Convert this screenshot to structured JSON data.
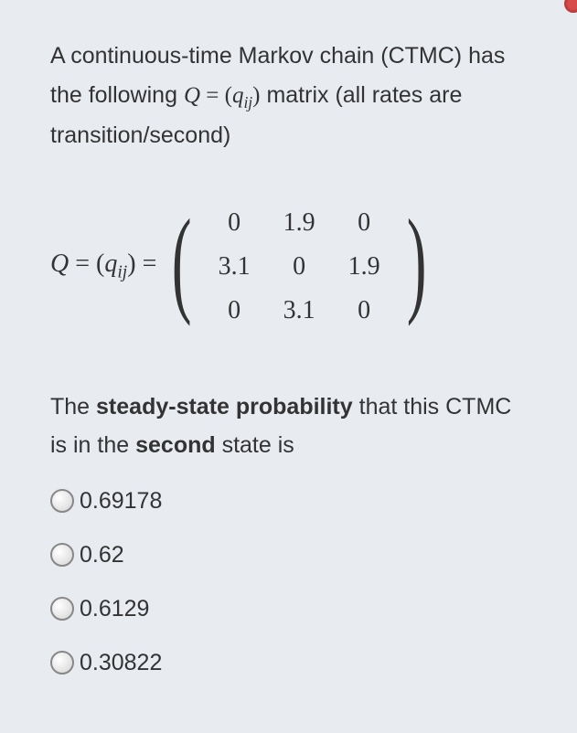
{
  "intro": {
    "pre": "A continuous-time Markov chain (CTMC) has the following ",
    "Q": "Q",
    "eq": " = ",
    "qij_open": "(",
    "q": "q",
    "ij": "ij",
    "qij_close": ")",
    "post": " matrix (all rates are transition/second)"
  },
  "equation": {
    "Q": "Q",
    "eq1": " = ",
    "qij_open": "(",
    "q": "q",
    "ij": "ij",
    "qij_close": ")",
    "eq2": " = "
  },
  "chart_data": {
    "type": "table",
    "title": "Q matrix",
    "rows": [
      [
        "0",
        "1.9",
        "0"
      ],
      [
        "3.1",
        "0",
        "1.9"
      ],
      [
        "0",
        "3.1",
        "0"
      ]
    ]
  },
  "followup": {
    "pre": "The ",
    "bold1": "steady-state probability",
    "mid": " that this CTMC is in the ",
    "bold2": "second",
    "post": " state is"
  },
  "options": [
    {
      "label": "0.69178"
    },
    {
      "label": "0.62"
    },
    {
      "label": "0.6129"
    },
    {
      "label": "0.30822"
    }
  ]
}
